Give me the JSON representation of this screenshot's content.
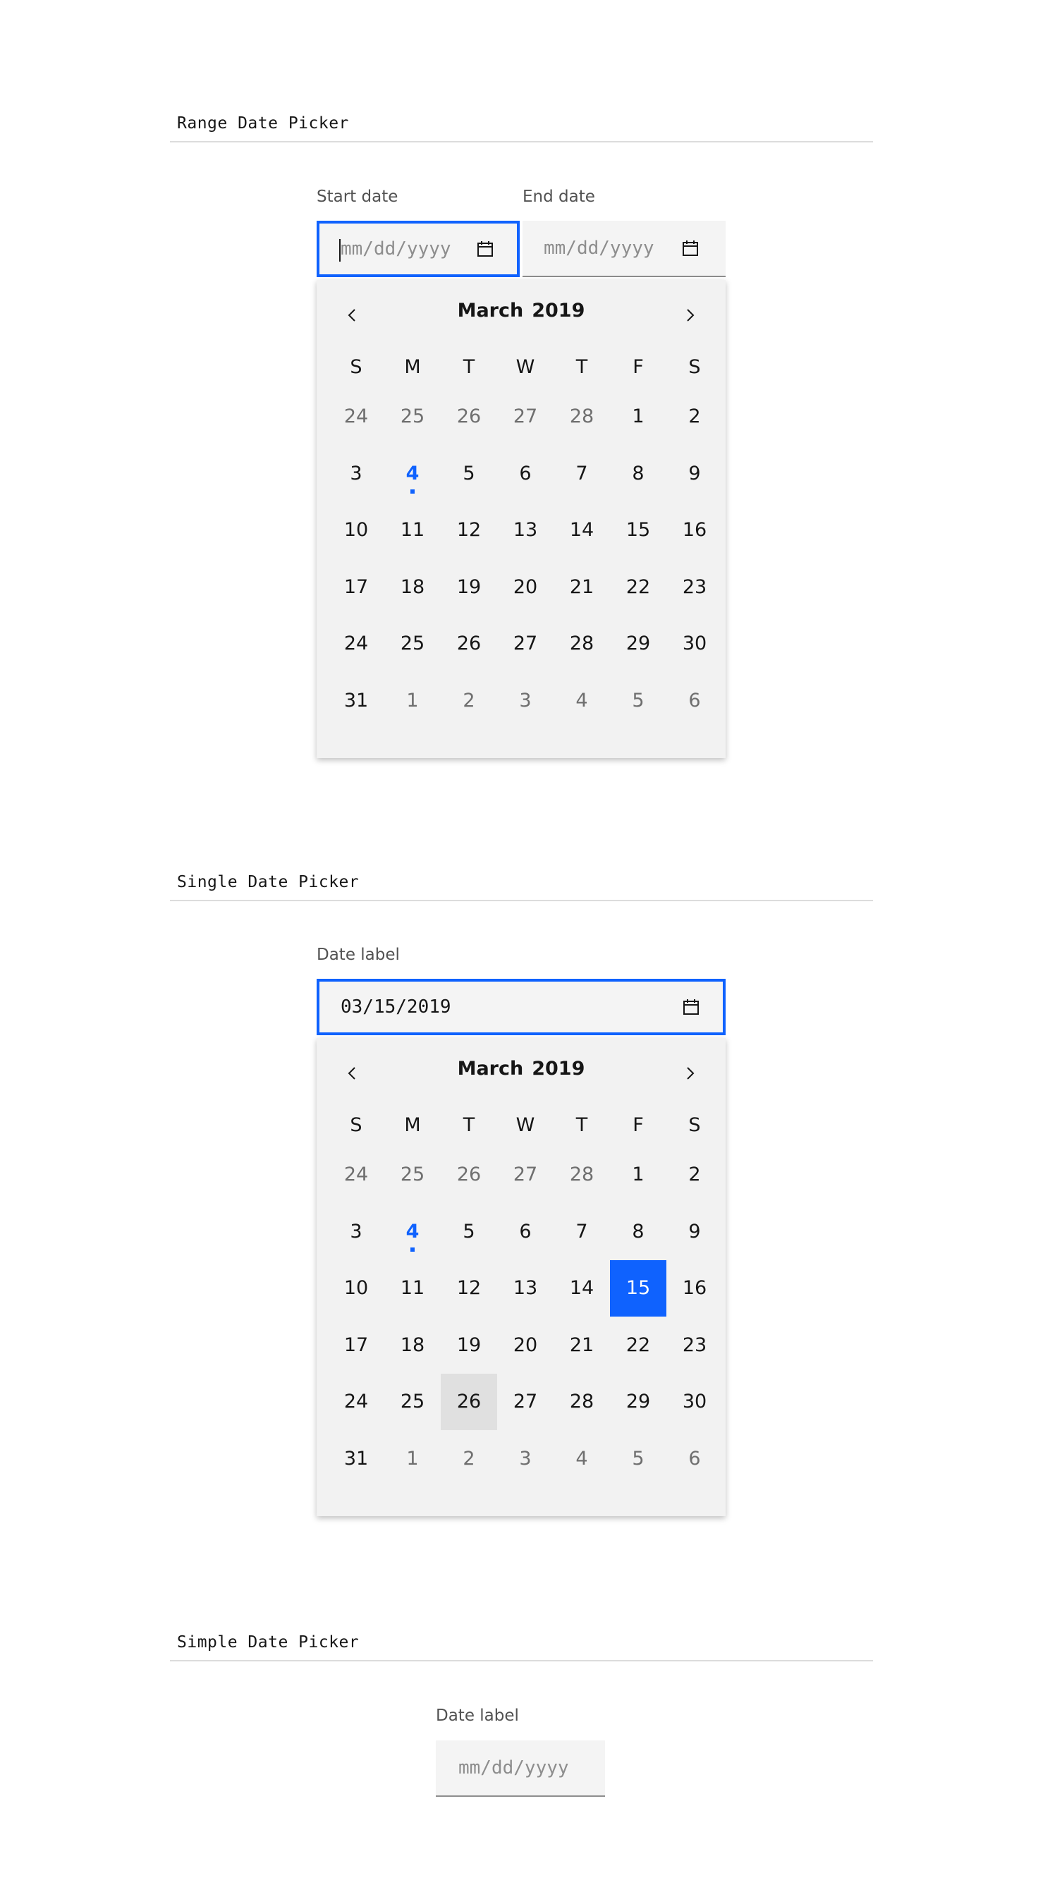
{
  "range_picker": {
    "section_title": "Range Date Picker",
    "start_label": "Start date",
    "end_label": "End date",
    "start_placeholder": "mm/dd/yyyy",
    "end_placeholder": "mm/dd/yyyy",
    "calendar": {
      "month": "March",
      "year": "2019",
      "selected_day": null,
      "hover_day": null
    }
  },
  "single_picker": {
    "section_title": "Single Date Picker",
    "label": "Date label",
    "value": "03/15/2019",
    "calendar": {
      "month": "March",
      "year": "2019",
      "selected_day": 15,
      "hover_day": 26
    }
  },
  "simple_picker": {
    "section_title": "Simple Date Picker",
    "label": "Date label",
    "placeholder": "mm/dd/yyyy"
  },
  "weekdays": [
    "S",
    "M",
    "T",
    "W",
    "T",
    "F",
    "S"
  ],
  "calendar_weeks": [
    [
      [
        24,
        0
      ],
      [
        25,
        0
      ],
      [
        26,
        0
      ],
      [
        27,
        0
      ],
      [
        28,
        0
      ],
      [
        1,
        1
      ],
      [
        2,
        1
      ]
    ],
    [
      [
        3,
        1
      ],
      [
        4,
        1
      ],
      [
        5,
        1
      ],
      [
        6,
        1
      ],
      [
        7,
        1
      ],
      [
        8,
        1
      ],
      [
        9,
        1
      ]
    ],
    [
      [
        10,
        1
      ],
      [
        11,
        1
      ],
      [
        12,
        1
      ],
      [
        13,
        1
      ],
      [
        14,
        1
      ],
      [
        15,
        1
      ],
      [
        16,
        1
      ]
    ],
    [
      [
        17,
        1
      ],
      [
        18,
        1
      ],
      [
        19,
        1
      ],
      [
        20,
        1
      ],
      [
        21,
        1
      ],
      [
        22,
        1
      ],
      [
        23,
        1
      ]
    ],
    [
      [
        24,
        1
      ],
      [
        25,
        1
      ],
      [
        26,
        1
      ],
      [
        27,
        1
      ],
      [
        28,
        1
      ],
      [
        29,
        1
      ],
      [
        30,
        1
      ]
    ],
    [
      [
        31,
        1
      ],
      [
        1,
        0
      ],
      [
        2,
        0
      ],
      [
        3,
        0
      ],
      [
        4,
        0
      ],
      [
        5,
        0
      ],
      [
        6,
        0
      ]
    ]
  ],
  "today_day": 4,
  "icons": {
    "calendar": "calendar-icon",
    "prev": "chevron-left-icon",
    "next": "chevron-right-icon"
  },
  "colors": {
    "accent": "#0f62fe",
    "field_bg": "#f4f4f4",
    "calendar_bg": "#f2f2f2",
    "hover": "#e0e0e0"
  }
}
